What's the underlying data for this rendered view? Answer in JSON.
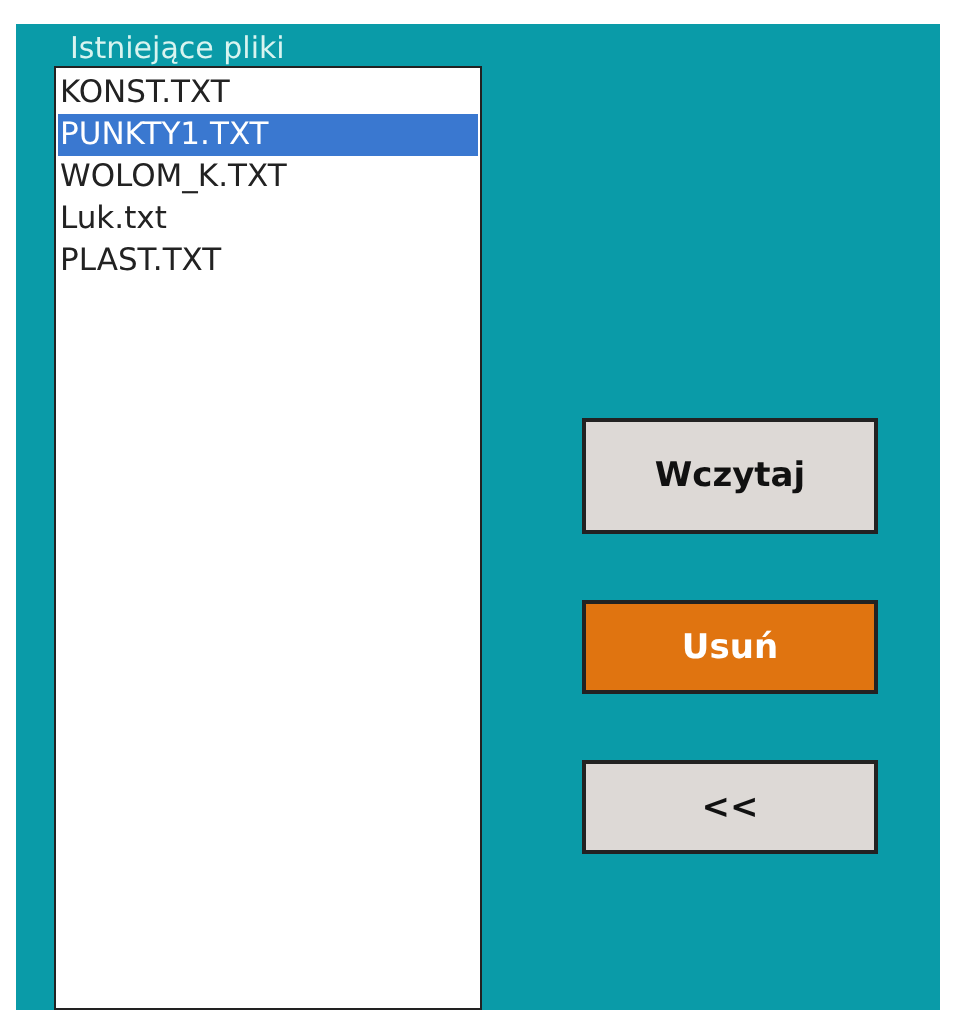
{
  "file_list": {
    "label": "Istniejące pliki",
    "items": [
      {
        "name": "KONST.TXT",
        "selected": false
      },
      {
        "name": "PUNKTY1.TXT",
        "selected": true
      },
      {
        "name": "WOLOM_K.TXT",
        "selected": false
      },
      {
        "name": "Luk.txt",
        "selected": false
      },
      {
        "name": "PLAST.TXT",
        "selected": false
      }
    ]
  },
  "buttons": [
    {
      "label": "Wczytaj",
      "kind": "default"
    },
    {
      "label": "Usuń",
      "kind": "accent"
    },
    {
      "label": "<<",
      "kind": "default"
    }
  ]
}
